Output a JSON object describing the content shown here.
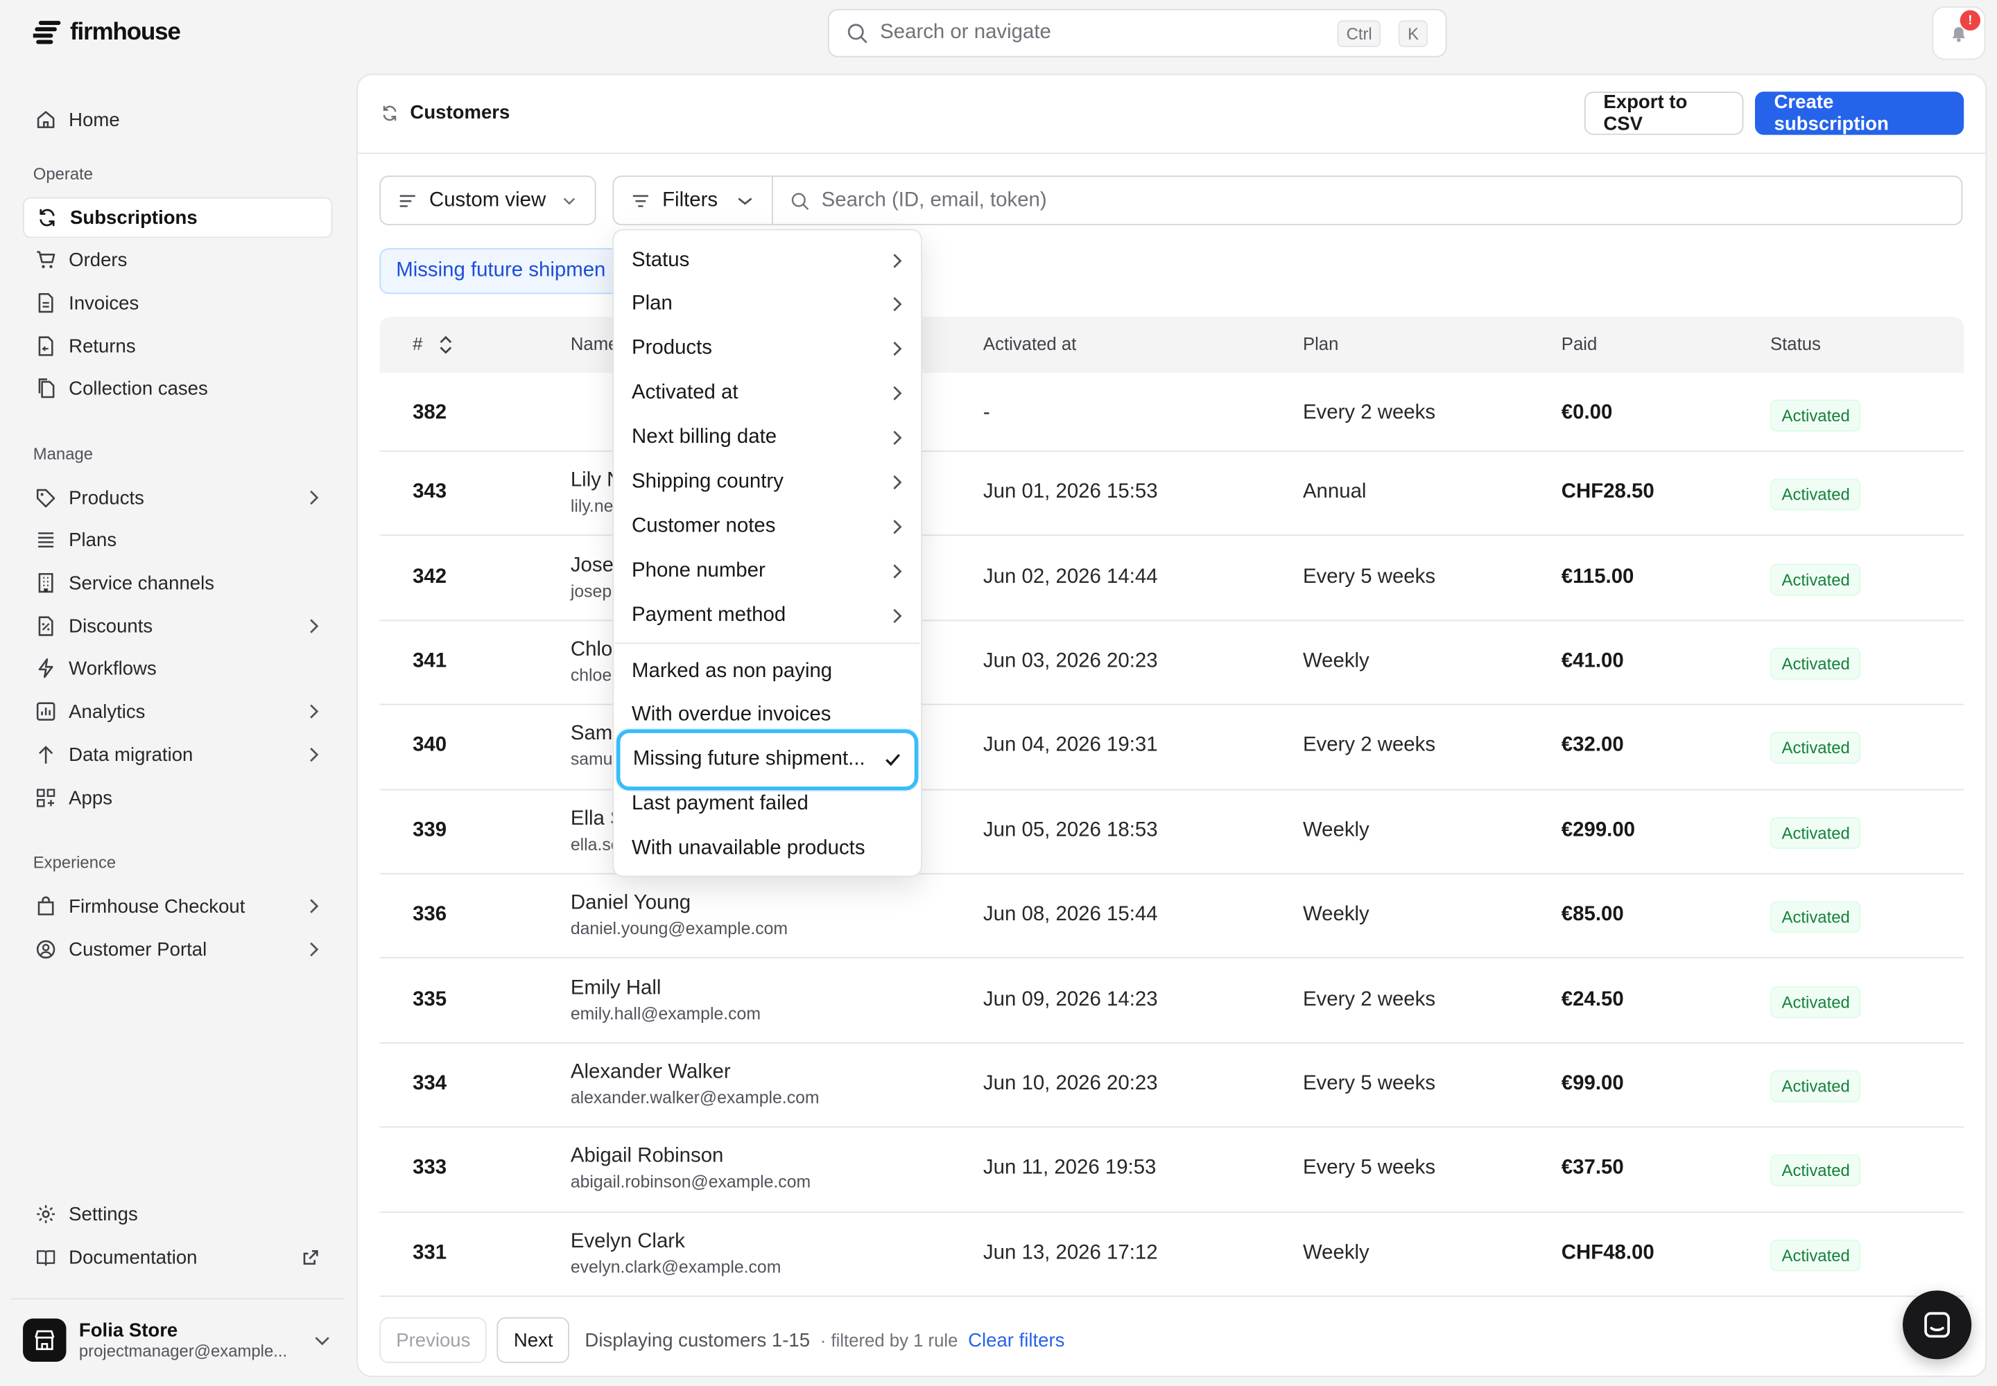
{
  "app": {
    "logo_text": "firmhouse"
  },
  "search": {
    "placeholder": "Search or navigate",
    "kbd1": "Ctrl",
    "kbd2": "K"
  },
  "notifications": {
    "badge": "!"
  },
  "sidebar": {
    "home": "Home",
    "section_operate": "Operate",
    "subscriptions": "Subscriptions",
    "orders": "Orders",
    "invoices": "Invoices",
    "returns": "Returns",
    "collection_cases": "Collection cases",
    "section_manage": "Manage",
    "products": "Products",
    "plans": "Plans",
    "service_channels": "Service channels",
    "discounts": "Discounts",
    "workflows": "Workflows",
    "analytics": "Analytics",
    "data_migration": "Data migration",
    "apps": "Apps",
    "section_experience": "Experience",
    "firmhouse_checkout": "Firmhouse Checkout",
    "customer_portal": "Customer Portal",
    "settings": "Settings",
    "documentation": "Documentation"
  },
  "store": {
    "name": "Folia Store",
    "email": "projectmanager@example..."
  },
  "header": {
    "title": "Customers",
    "export": "Export to CSV",
    "create": "Create subscription"
  },
  "toolbar": {
    "view": "Custom view",
    "filters": "Filters",
    "search_placeholder": "Search (ID, email, token)"
  },
  "active_filter_chip": "Missing future shipmen",
  "table": {
    "columns": {
      "num": "#",
      "name": "Name",
      "activated": "Activated at",
      "plan": "Plan",
      "paid": "Paid",
      "status": "Status"
    },
    "rows": [
      {
        "num": "382",
        "name": "",
        "email": "",
        "activated": "-",
        "plan": "Every 2 weeks",
        "paid": "€0.00",
        "status": "Activated"
      },
      {
        "num": "343",
        "name": "Lily N",
        "email": "lily.ne",
        "activated": "Jun 01, 2026 15:53",
        "plan": "Annual",
        "paid": "CHF28.50",
        "status": "Activated"
      },
      {
        "num": "342",
        "name": "Jose",
        "email": "josep",
        "activated": "Jun 02, 2026 14:44",
        "plan": "Every 5 weeks",
        "paid": "€115.00",
        "status": "Activated"
      },
      {
        "num": "341",
        "name": "Chlo",
        "email": "chloe",
        "activated": "Jun 03, 2026 20:23",
        "plan": "Weekly",
        "paid": "€41.00",
        "status": "Activated"
      },
      {
        "num": "340",
        "name": "Sam",
        "email": "samu",
        "activated": "Jun 04, 2026 19:31",
        "plan": "Every 2 weeks",
        "paid": "€32.00",
        "status": "Activated"
      },
      {
        "num": "339",
        "name": "Ella S",
        "email": "ella.sc",
        "activated": "Jun 05, 2026 18:53",
        "plan": "Weekly",
        "paid": "€299.00",
        "status": "Activated"
      },
      {
        "num": "336",
        "name": "Daniel Young",
        "email": "daniel.young@example.com",
        "activated": "Jun 08, 2026 15:44",
        "plan": "Weekly",
        "paid": "€85.00",
        "status": "Activated"
      },
      {
        "num": "335",
        "name": "Emily Hall",
        "email": "emily.hall@example.com",
        "activated": "Jun 09, 2026 14:23",
        "plan": "Every 2 weeks",
        "paid": "€24.50",
        "status": "Activated"
      },
      {
        "num": "334",
        "name": "Alexander Walker",
        "email": "alexander.walker@example.com",
        "activated": "Jun 10, 2026 20:23",
        "plan": "Every 5 weeks",
        "paid": "€99.00",
        "status": "Activated"
      },
      {
        "num": "333",
        "name": "Abigail Robinson",
        "email": "abigail.robinson@example.com",
        "activated": "Jun 11, 2026 19:53",
        "plan": "Every 5 weeks",
        "paid": "€37.50",
        "status": "Activated"
      },
      {
        "num": "331",
        "name": "Evelyn Clark",
        "email": "evelyn.clark@example.com",
        "activated": "Jun 13, 2026 17:12",
        "plan": "Weekly",
        "paid": "CHF48.00",
        "status": "Activated"
      }
    ]
  },
  "footer": {
    "previous": "Previous",
    "next": "Next",
    "displaying": "Displaying customers 1-15",
    "filtered": "· filtered by 1 rule",
    "clear": "Clear filters"
  },
  "filter_menu": {
    "submenu_items": [
      "Status",
      "Plan",
      "Products",
      "Activated at",
      "Next billing date",
      "Shipping country",
      "Customer notes",
      "Phone number",
      "Payment method"
    ],
    "toggle_items": [
      "Marked as non paying",
      "With overdue invoices",
      "Missing future shipment...",
      "Last payment failed",
      "With unavailable products"
    ],
    "selected_index": 2
  },
  "colors": {
    "primary": "#2563eb",
    "highlight": "#38bdf8",
    "status_green": "#15803d"
  }
}
